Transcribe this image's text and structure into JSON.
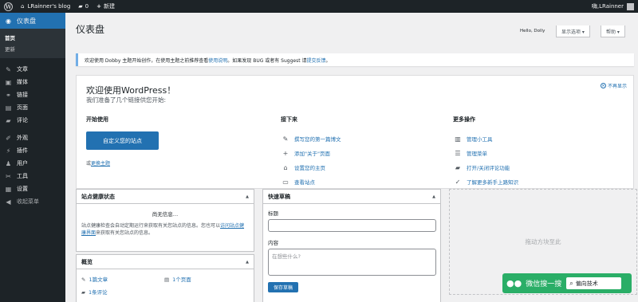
{
  "adminbar": {
    "site_name": "LRainner's blog",
    "comments_count": "0",
    "new_label": "新建",
    "user_name": "LRainner",
    "user_prefix": "嗨,"
  },
  "sidebar": {
    "items": [
      {
        "label": "仪表盘",
        "icon": "dashboard-icon",
        "glyph": "◉"
      },
      {
        "label": "文章",
        "icon": "pin-icon",
        "glyph": "✎"
      },
      {
        "label": "媒体",
        "icon": "media-icon",
        "glyph": "▣"
      },
      {
        "label": "链接",
        "icon": "link-icon",
        "glyph": "⚭"
      },
      {
        "label": "页面",
        "icon": "page-icon",
        "glyph": "▤"
      },
      {
        "label": "评论",
        "icon": "comment-icon",
        "glyph": "▰"
      },
      {
        "label": "外观",
        "icon": "appearance-icon",
        "glyph": "✐"
      },
      {
        "label": "插件",
        "icon": "plugin-icon",
        "glyph": "⚡"
      },
      {
        "label": "用户",
        "icon": "user-icon",
        "glyph": "♟"
      },
      {
        "label": "工具",
        "icon": "tool-icon",
        "glyph": "✂"
      },
      {
        "label": "设置",
        "icon": "settings-icon",
        "glyph": "▦"
      },
      {
        "label": "收起菜单",
        "icon": "collapse-icon",
        "glyph": "◀"
      }
    ],
    "submenu": {
      "home": "首页",
      "updates": "更新"
    }
  },
  "header": {
    "title": "仪表盘",
    "hello": "Hello, Dolly",
    "screen_options": "显示选项 ▾",
    "help": "帮助 ▾"
  },
  "notice": {
    "text_before": "欢迎使用 Dobby 主题开始创作，在使用主题之前推荐查看",
    "link1": "使用说明",
    "text_mid": "。如果发现 BUG 或者有 Suggest 请",
    "link2": "提交反馈",
    "text_end": "。"
  },
  "welcome": {
    "title": "欢迎使用WordPress！",
    "subtitle": "我们准备了几个链接供您开始:",
    "dismiss": "不再显示",
    "col1": {
      "heading": "开始使用",
      "button": "自定义您的站点",
      "alt_prefix": "或",
      "alt_link": "更换主题"
    },
    "col2": {
      "heading": "接下来",
      "actions": [
        {
          "label": "撰写您的第一篇博文",
          "icon": "edit-icon",
          "glyph": "✎"
        },
        {
          "label": "添加\"关于\"页面",
          "icon": "plus-icon",
          "glyph": "+"
        },
        {
          "label": "设置您的主页",
          "icon": "home-icon",
          "glyph": "⌂"
        },
        {
          "label": "查看站点",
          "icon": "view-site-icon",
          "glyph": "▭"
        }
      ]
    },
    "col3": {
      "heading": "更多操作",
      "actions": [
        {
          "label": "管理小工具",
          "icon": "widgets-icon",
          "glyph": "▥"
        },
        {
          "label": "管理菜单",
          "icon": "menus-icon",
          "glyph": "☰"
        },
        {
          "label": "打开/关闭评论功能",
          "icon": "comments-toggle-icon",
          "glyph": "▰"
        },
        {
          "label": "了解更多新手上路知识",
          "icon": "learn-icon",
          "glyph": "✓"
        }
      ]
    }
  },
  "site_health": {
    "title": "站点健康状态",
    "no_info": "尚无信息…",
    "desc_before": "站点健康检查会自动定期运行来获取有关您站点的信息。您也可以",
    "desc_link": "访问站点健康界面",
    "desc_after": "来获取有关您站点的信息。"
  },
  "overview": {
    "title": "概览",
    "posts": "1篇文章",
    "pages": "1个页面",
    "comments": "1条评论"
  },
  "quick_draft": {
    "title": "快速草稿",
    "title_label": "标题",
    "content_label": "内容",
    "content_placeholder": "在想些什么?",
    "save": "保存草稿"
  },
  "dropzone": {
    "label": "拖动方块至此"
  },
  "wechat": {
    "text": "微信搜一搜",
    "search_value": "偏向技术"
  },
  "colors": {
    "accent": "#2271b1",
    "adminbar": "#1d2327",
    "wechat": "#2aae67"
  }
}
